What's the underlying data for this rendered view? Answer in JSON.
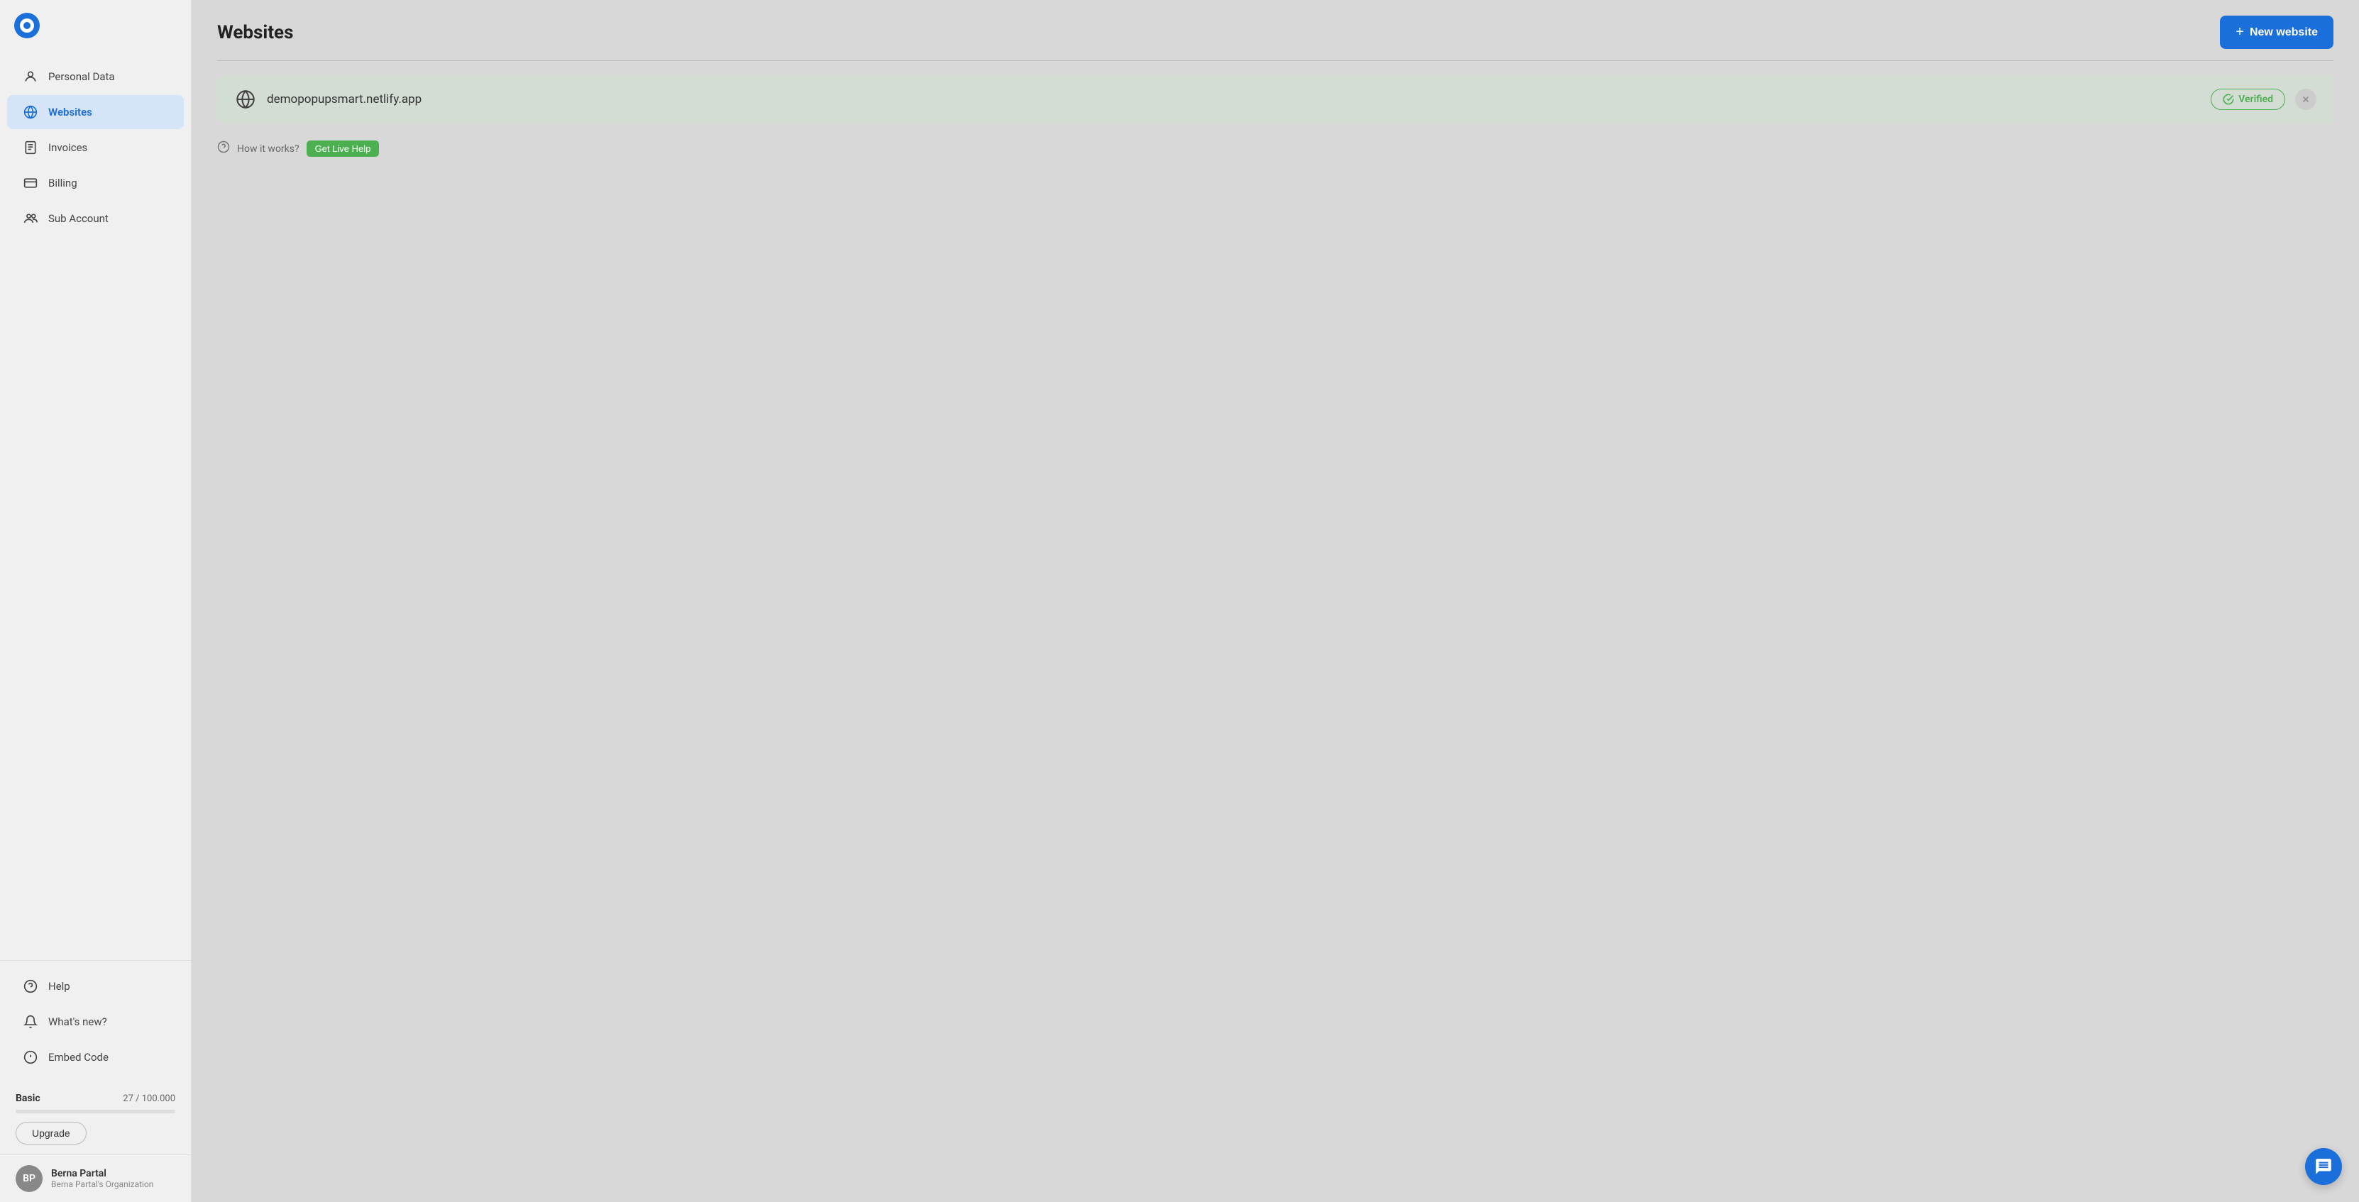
{
  "app": {
    "title": "Websites"
  },
  "sidebar": {
    "nav_items": [
      {
        "id": "personal-data",
        "label": "Personal Data",
        "icon": "person"
      },
      {
        "id": "websites",
        "label": "Websites",
        "icon": "globe",
        "active": true
      },
      {
        "id": "invoices",
        "label": "Invoices",
        "icon": "receipt"
      },
      {
        "id": "billing",
        "label": "Billing",
        "icon": "card"
      },
      {
        "id": "sub-account",
        "label": "Sub Account",
        "icon": "people"
      }
    ],
    "bottom_items": [
      {
        "id": "help",
        "label": "Help",
        "icon": "help-circle"
      },
      {
        "id": "whats-new",
        "label": "What's new?",
        "icon": "bell"
      },
      {
        "id": "embed-code",
        "label": "Embed Code",
        "icon": "code"
      }
    ],
    "plan": {
      "name": "Basic",
      "current": "27",
      "max": "100.000",
      "progress_pct": 0.027,
      "upgrade_label": "Upgrade"
    },
    "user": {
      "name": "Berna Partal",
      "org": "Berna Partal's Organization",
      "initials": "BP"
    }
  },
  "header": {
    "title": "Websites",
    "new_button": "New website"
  },
  "website": {
    "url": "demopopupsmart.netlify.app",
    "verified_label": "Verified"
  },
  "how_it_works": {
    "text": "How it works?",
    "live_help_label": "Get Live Help"
  }
}
